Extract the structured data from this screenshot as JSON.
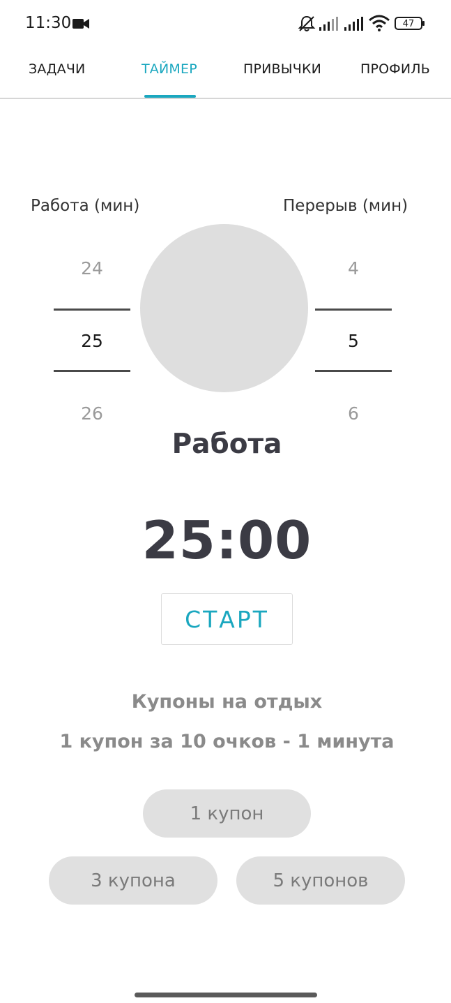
{
  "status_bar": {
    "time": "11:30",
    "battery": "47",
    "icons": [
      "video-camera-icon",
      "bell-off-icon",
      "signal-icon",
      "signal-icon",
      "wifi-icon",
      "battery-icon"
    ]
  },
  "tabs": [
    {
      "label": "ЗАДАЧИ",
      "active": false
    },
    {
      "label": "ТАЙМЕР",
      "active": true
    },
    {
      "label": "ПРИВЫЧКИ",
      "active": false
    },
    {
      "label": "ПРОФИЛЬ",
      "active": false
    }
  ],
  "colors": {
    "accent": "#1aa7bf",
    "circle": "#dedede",
    "pill": "#e0e0e0",
    "heading": "#3b3b44",
    "muted": "#8a8a8a"
  },
  "work_picker": {
    "label": "Работа (мин)",
    "prev": "24",
    "current": "25",
    "next": "26"
  },
  "break_picker": {
    "label": "Перерыв (мин)",
    "prev": "4",
    "current": "5",
    "next": "6"
  },
  "timer": {
    "phase": "Работа",
    "time": "25:00",
    "start_label": "СТАРТ"
  },
  "coupons": {
    "title": "Купоны на отдых",
    "subtitle": "1 купон за 10 очков - 1 минута",
    "options": [
      "1 купон",
      "3 купона",
      "5 купонов"
    ]
  }
}
